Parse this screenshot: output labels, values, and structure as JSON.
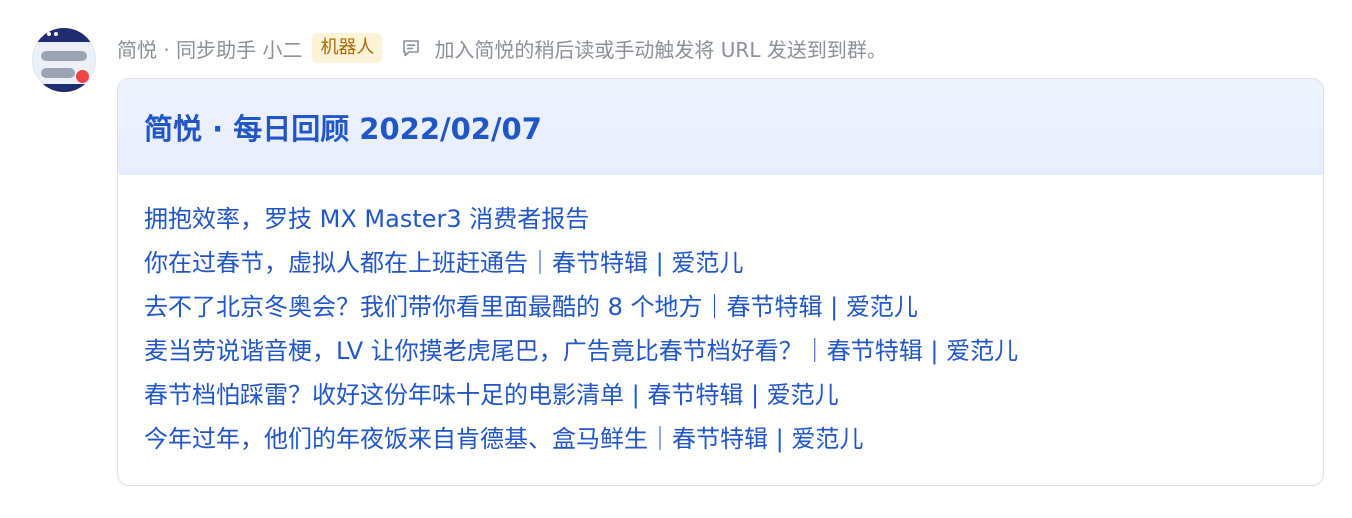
{
  "sender": {
    "name": "简悦 · 同步助手 小二",
    "badge": "机器人",
    "note_icon": "message-square-icon",
    "note": "加入简悦的稍后读或手动触发将 URL 发送到到群。"
  },
  "card": {
    "title": "简悦 · 每日回顾 2022/02/07",
    "links": [
      "拥抱效率，罗技 MX Master3 消费者报告",
      "你在过春节，虚拟人都在上班赶通告｜春节特辑 | 爱范儿",
      "去不了北京冬奥会？我们带你看里面最酷的 8 个地方｜春节特辑 | 爱范儿",
      "麦当劳说谐音梗，LV 让你摸老虎尾巴，广告竟比春节档好看？｜春节特辑 | 爱范儿",
      "春节档怕踩雷？收好这份年味十足的电影清单 | 春节特辑 | 爱范儿",
      "今年过年，他们的年夜饭来自肯德基、盒马鲜生｜春节特辑 | 爱范儿"
    ]
  },
  "colors": {
    "link": "#2156c7",
    "meta_text": "#8a8f99",
    "badge_bg": "#fdf3d6",
    "badge_text": "#a96a07",
    "header_bg": "#e9eefc"
  }
}
